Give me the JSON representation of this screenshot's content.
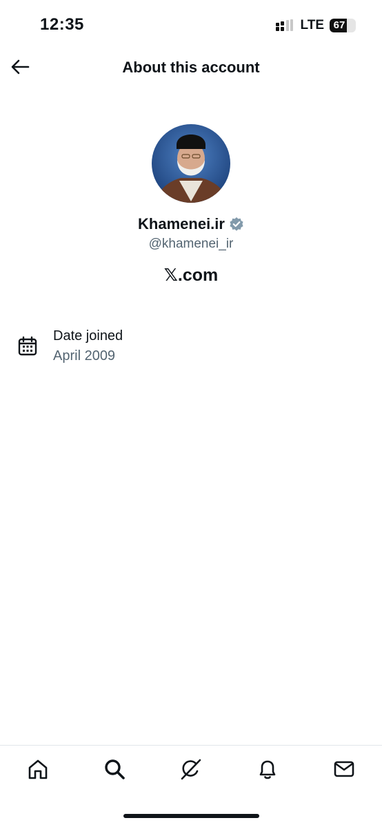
{
  "status_bar": {
    "time": "12:35",
    "network": "LTE",
    "battery": "67",
    "battery_level": 0.67
  },
  "header": {
    "title": "About this account"
  },
  "profile": {
    "display_name": "Khamenei.ir",
    "handle": "@khamenei_ir",
    "brand": "𝕏.com",
    "verified": true,
    "verified_color": "#829aab"
  },
  "details": {
    "date_joined_label": "Date joined",
    "date_joined_value": "April 2009"
  },
  "tab_bar": {
    "icons": [
      "home-icon",
      "search-icon",
      "grok-icon",
      "bell-icon",
      "mail-icon"
    ]
  }
}
